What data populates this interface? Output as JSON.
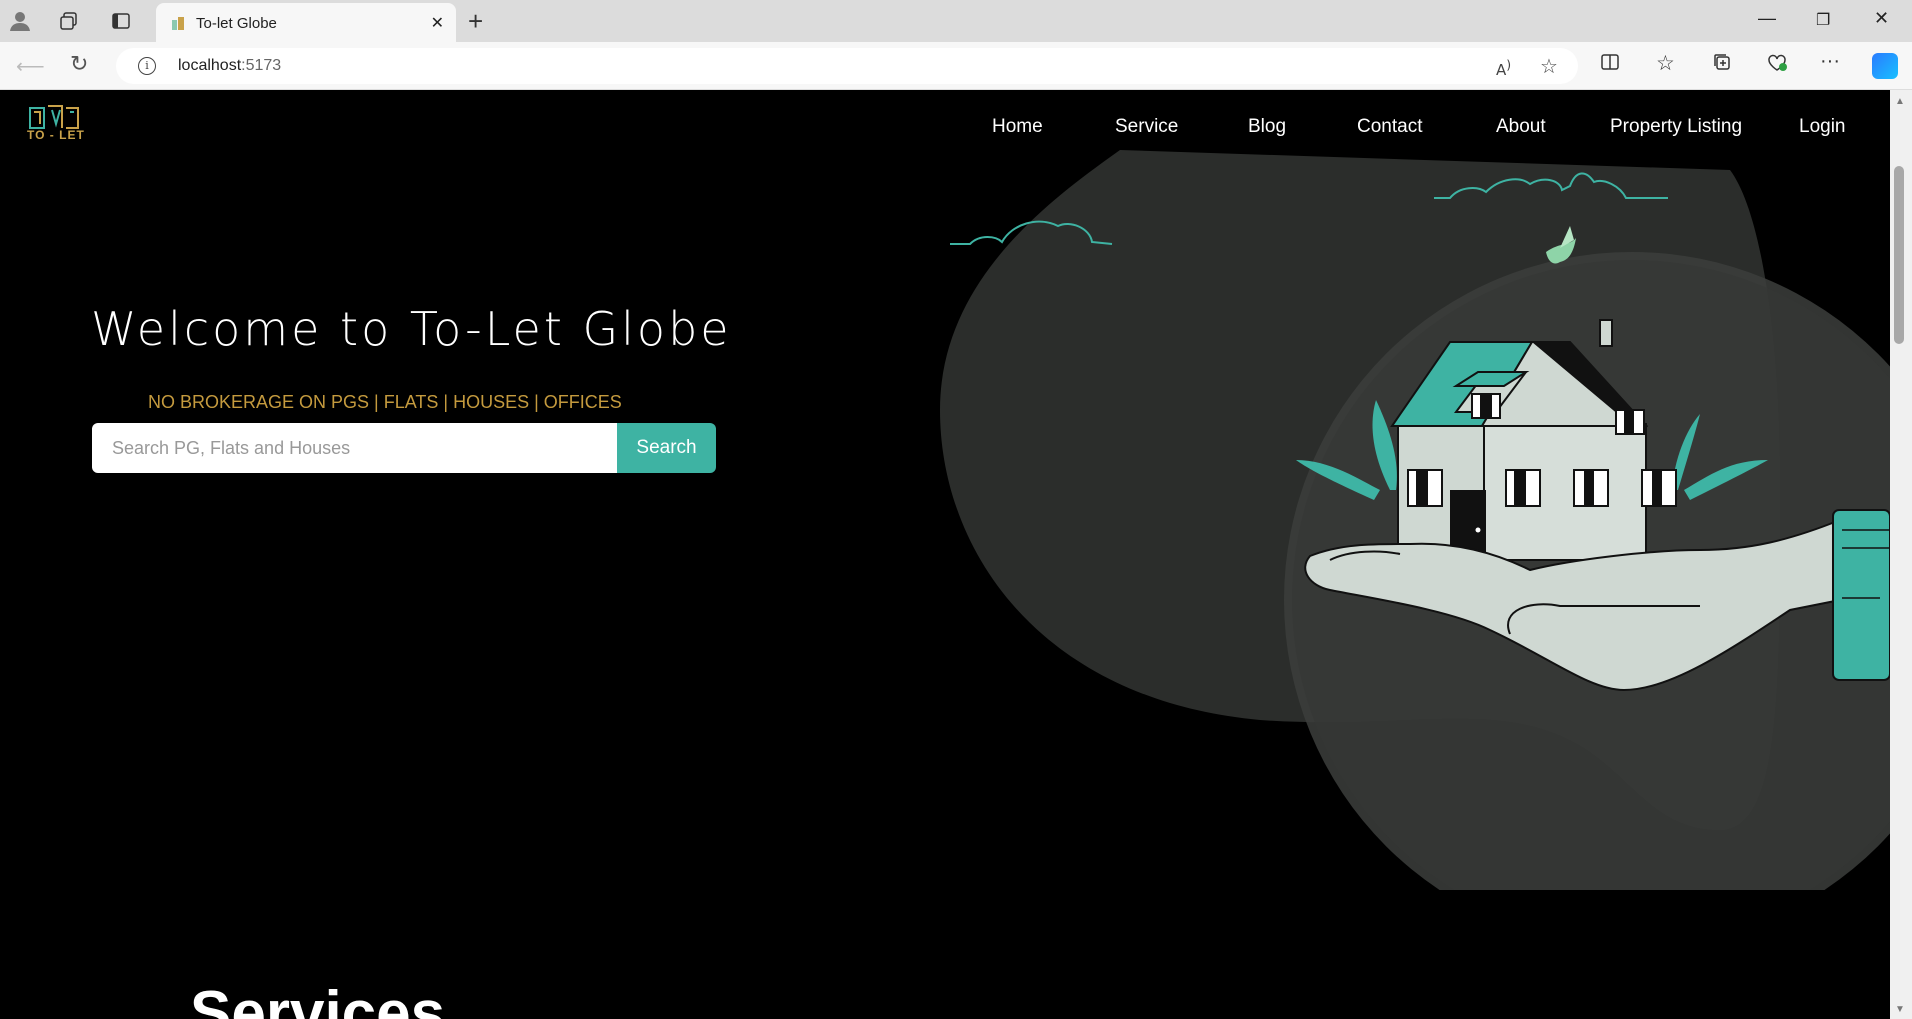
{
  "browser": {
    "tab_title": "To-let Globe",
    "url_host": "localhost",
    "url_port": ":5173"
  },
  "site": {
    "logo_text": "TO - LET",
    "nav": [
      {
        "label": "Home"
      },
      {
        "label": "Service"
      },
      {
        "label": "Blog"
      },
      {
        "label": "Contact"
      },
      {
        "label": "About"
      },
      {
        "label": "Property Listing"
      },
      {
        "label": "Login"
      }
    ]
  },
  "hero": {
    "title": "Welcome to To-Let Globe",
    "tagline": "NO BROKERAGE ON PGS | FLATS | HOUSES | OFFICES",
    "search_placeholder": "Search PG, Flats and Houses",
    "search_button": "Search"
  },
  "services": {
    "heading": "Services"
  },
  "colors": {
    "accent": "#3eb3a3",
    "tagline": "#c49a3e",
    "background": "#000000",
    "blob": "#2b2d2b"
  }
}
